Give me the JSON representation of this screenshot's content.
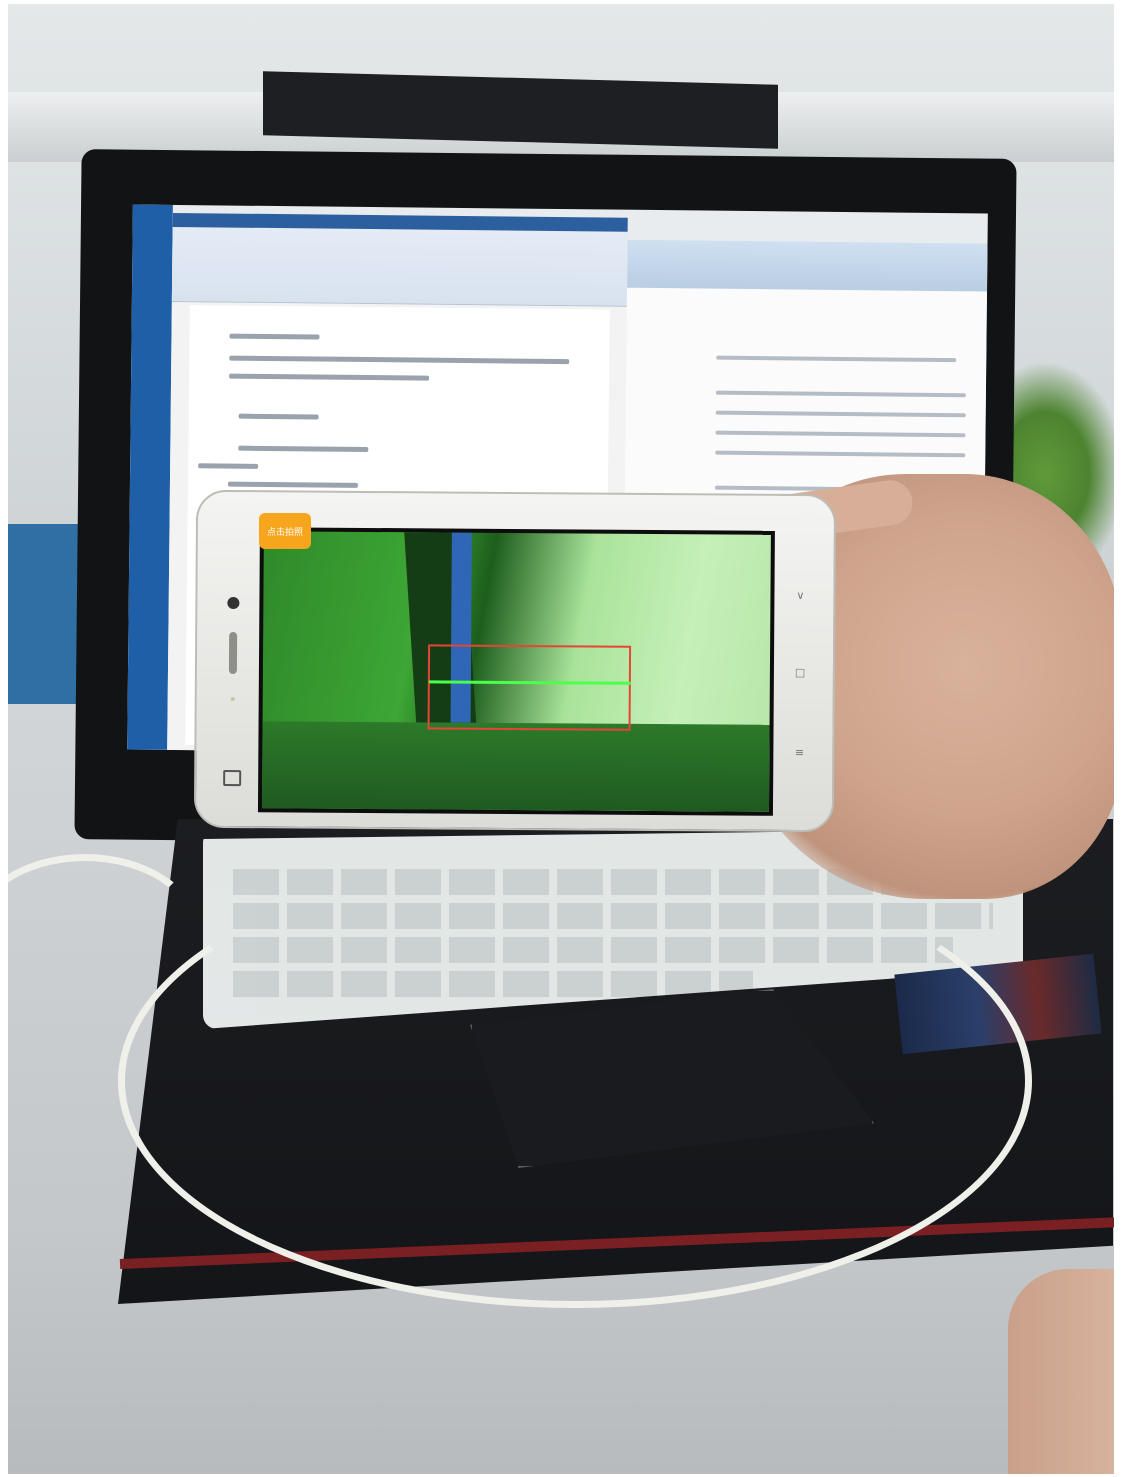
{
  "phone_app": {
    "capture_button_label": "点击拍照"
  },
  "colors": {
    "capture_button": "#f7a51c",
    "detection_box": "#e84436",
    "scan_line": "#4cff4c",
    "camera_tint": "#3da635"
  }
}
